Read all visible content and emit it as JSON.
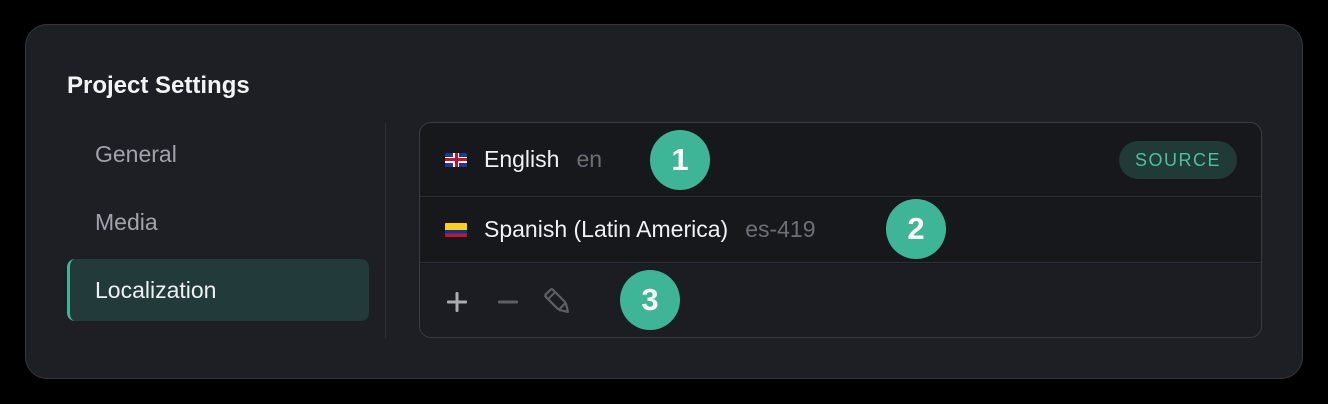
{
  "settings": {
    "title": "Project Settings"
  },
  "nav": {
    "items": [
      {
        "label": "General"
      },
      {
        "label": "Media"
      },
      {
        "label": "Localization",
        "active": true
      }
    ]
  },
  "languages": [
    {
      "flag": "uk-flag",
      "name": "English",
      "code": "en",
      "badge": "SOURCE"
    },
    {
      "flag": "colombia-flag",
      "name": "Spanish (Latin America)",
      "code": "es-419"
    }
  ],
  "toolbar": {
    "add_icon": "plus-icon",
    "remove_icon": "minus-icon",
    "edit_icon": "pencil-icon"
  },
  "markers": [
    "1",
    "2",
    "3"
  ],
  "colors": {
    "accent": "#3fb597",
    "panel": "#1e1f24",
    "active_nav": "#233a3b",
    "badge_bg": "#1f3a37"
  }
}
